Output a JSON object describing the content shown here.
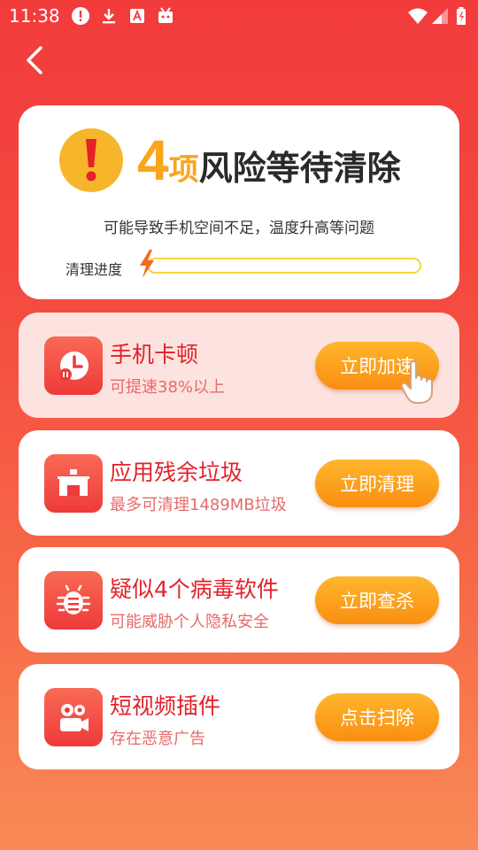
{
  "status_bar": {
    "time": "11:38"
  },
  "hero": {
    "count": "4",
    "count_unit": "项",
    "headline_rest": "风险等待清除",
    "subtitle": "可能导致手机空间不足，温度升高等问题",
    "progress_label": "清理进度",
    "progress_fraction": 0.0,
    "accent_color": "#f9a51e"
  },
  "items": [
    {
      "title": "手机卡顿",
      "subtitle": "可提速38%以上",
      "button": "立即加速",
      "icon": "speed-clock-icon"
    },
    {
      "title": "应用残余垃圾",
      "subtitle": "最多可清理1489MB垃圾",
      "button": "立即清理",
      "icon": "house-trash-icon"
    },
    {
      "title": "疑似4个病毒软件",
      "subtitle": "可能威胁个人隐私安全",
      "button": "立即查杀",
      "icon": "bug-icon"
    },
    {
      "title": "短视频插件",
      "subtitle": "存在恶意广告",
      "button": "点击扫除",
      "icon": "video-camera-icon"
    }
  ],
  "colors": {
    "title_red": "#e3222a",
    "button_orange": "#f98e12",
    "background_red": "#f23c3c"
  }
}
